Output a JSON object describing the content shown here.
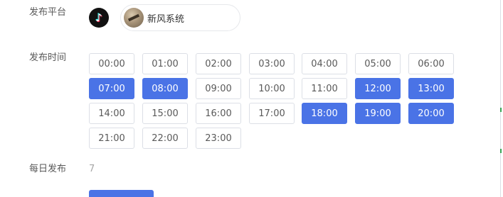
{
  "labels": {
    "platform": "发布平台",
    "publish_time": "发布时间",
    "daily_publish": "每日发布"
  },
  "platform": {
    "icon": "tiktok-icon",
    "account_name": "新风系统"
  },
  "time_slots": [
    {
      "label": "00:00",
      "selected": false
    },
    {
      "label": "01:00",
      "selected": false
    },
    {
      "label": "02:00",
      "selected": false
    },
    {
      "label": "03:00",
      "selected": false
    },
    {
      "label": "04:00",
      "selected": false
    },
    {
      "label": "05:00",
      "selected": false
    },
    {
      "label": "06:00",
      "selected": false
    },
    {
      "label": "07:00",
      "selected": true
    },
    {
      "label": "08:00",
      "selected": true
    },
    {
      "label": "09:00",
      "selected": false
    },
    {
      "label": "10:00",
      "selected": false
    },
    {
      "label": "11:00",
      "selected": false
    },
    {
      "label": "12:00",
      "selected": true
    },
    {
      "label": "13:00",
      "selected": true
    },
    {
      "label": "14:00",
      "selected": false
    },
    {
      "label": "15:00",
      "selected": false
    },
    {
      "label": "16:00",
      "selected": false
    },
    {
      "label": "17:00",
      "selected": false
    },
    {
      "label": "18:00",
      "selected": true
    },
    {
      "label": "19:00",
      "selected": true
    },
    {
      "label": "20:00",
      "selected": true
    },
    {
      "label": "21:00",
      "selected": false
    },
    {
      "label": "22:00",
      "selected": false
    },
    {
      "label": "23:00",
      "selected": false
    }
  ],
  "daily_publish_count": "7",
  "colors": {
    "accent": "#4a73e6",
    "border": "#dcdfe6",
    "label_text": "#595959"
  }
}
